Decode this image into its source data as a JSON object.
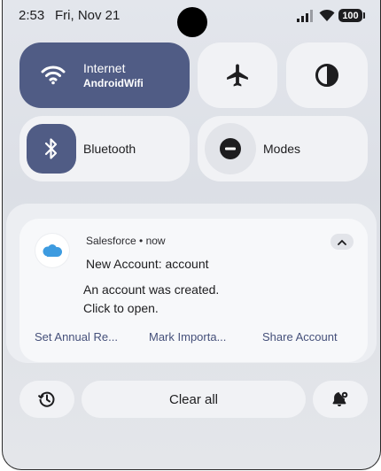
{
  "status_bar": {
    "time": "2:53",
    "date": "Fri, Nov 21",
    "battery": "100"
  },
  "quick_settings": {
    "internet": {
      "label": "Internet",
      "network": "AndroidWifi"
    },
    "bluetooth": {
      "label": "Bluetooth"
    },
    "modes": {
      "label": "Modes"
    },
    "accent_color": "#505c85"
  },
  "notification": {
    "app": "Salesforce • now",
    "title": "New Account: account",
    "body": "An account was created.\nClick to open.",
    "actions": [
      "Set Annual Re...",
      "Mark Importa...",
      "Share Account"
    ]
  },
  "footer": {
    "clear_all": "Clear all"
  },
  "icons": [
    "wifi-icon",
    "airplane-icon",
    "contrast-icon",
    "bluetooth-icon",
    "do-not-disturb-icon",
    "salesforce-cloud-icon",
    "chevron-up-icon",
    "history-icon",
    "notification-settings-icon"
  ]
}
